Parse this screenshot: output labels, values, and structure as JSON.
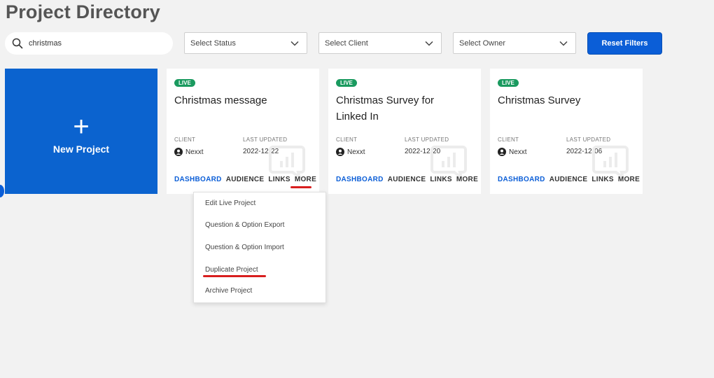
{
  "header": {
    "title": "Project Directory"
  },
  "filters": {
    "search_value": "christmas",
    "status_placeholder": "Select Status",
    "client_placeholder": "Select Client",
    "owner_placeholder": "Select Owner",
    "reset_label": "Reset Filters"
  },
  "new_project": {
    "plus": "+",
    "label": "New Project"
  },
  "cards": [
    {
      "status": "LIVE",
      "title": "Christmas message",
      "client_label": "CLIENT",
      "client": "Nexxt",
      "updated_label": "LAST UPDATED",
      "updated": "2022-12-22",
      "actions": [
        "DASHBOARD",
        "AUDIENCE",
        "LINKS",
        "MORE"
      ]
    },
    {
      "status": "LIVE",
      "title": "Christmas Survey for Linked In",
      "client_label": "CLIENT",
      "client": "Nexxt",
      "updated_label": "LAST UPDATED",
      "updated": "2022-12-20",
      "actions": [
        "DASHBOARD",
        "AUDIENCE",
        "LINKS",
        "MORE"
      ]
    },
    {
      "status": "LIVE",
      "title": "Christmas Survey",
      "client_label": "CLIENT",
      "client": "Nexxt",
      "updated_label": "LAST UPDATED",
      "updated": "2022-12-06",
      "actions": [
        "DASHBOARD",
        "AUDIENCE",
        "LINKS",
        "MORE"
      ]
    }
  ],
  "more_menu": {
    "items": [
      "Edit Live Project",
      "Question & Option Export",
      "Question & Option Import",
      "Duplicate Project",
      "Archive Project"
    ]
  },
  "colors": {
    "accent": "#0b5ed7",
    "live": "#1a9a5f",
    "highlight": "#d81e1e"
  }
}
